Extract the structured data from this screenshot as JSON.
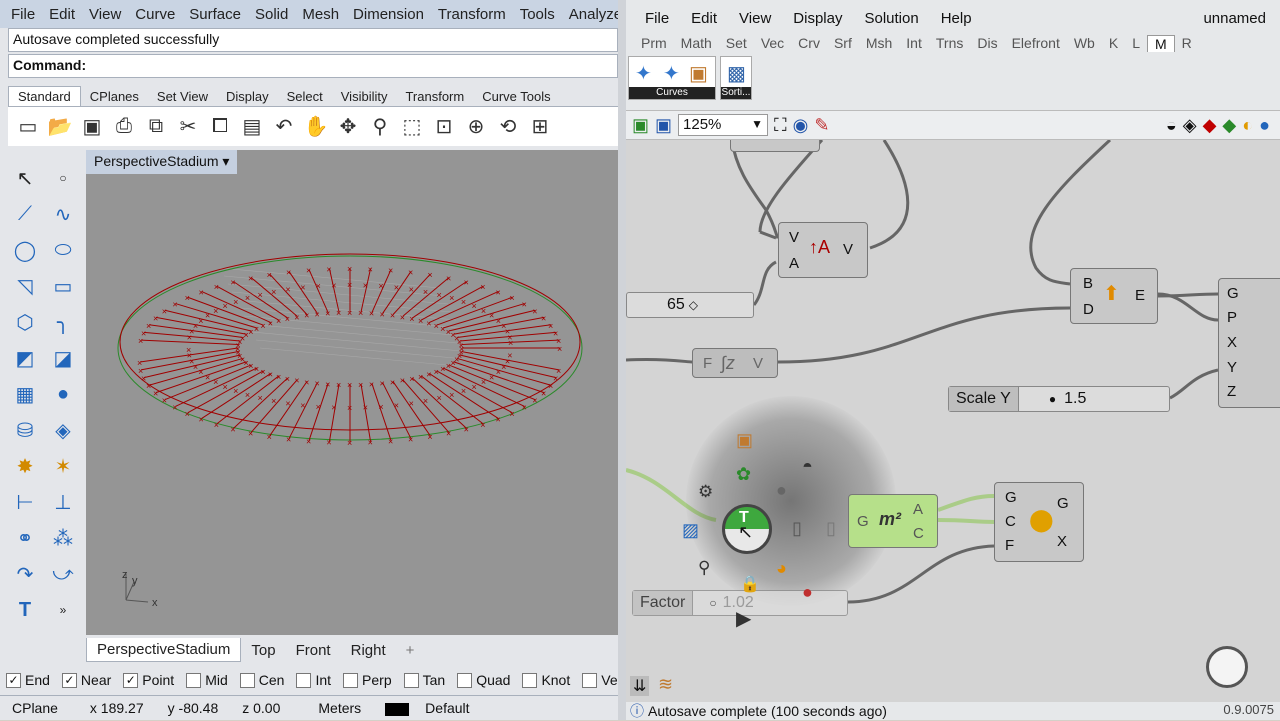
{
  "rhino": {
    "menu": [
      "File",
      "Edit",
      "View",
      "Curve",
      "Surface",
      "Solid",
      "Mesh",
      "Dimension",
      "Transform",
      "Tools",
      "Analyze"
    ],
    "cmd_history": "Autosave completed successfully",
    "command_label": "Command:",
    "tabs": [
      "Standard",
      "CPlanes",
      "Set View",
      "Display",
      "Select",
      "Visibility",
      "Transform",
      "Curve Tools"
    ],
    "viewport_title": "PerspectiveStadium",
    "viewport_tabs": [
      "PerspectiveStadium",
      "Top",
      "Front",
      "Right"
    ],
    "osnaps": [
      {
        "label": "End",
        "checked": true
      },
      {
        "label": "Near",
        "checked": true
      },
      {
        "label": "Point",
        "checked": true
      },
      {
        "label": "Mid",
        "checked": false
      },
      {
        "label": "Cen",
        "checked": false
      },
      {
        "label": "Int",
        "checked": false
      },
      {
        "label": "Perp",
        "checked": false
      },
      {
        "label": "Tan",
        "checked": false
      },
      {
        "label": "Quad",
        "checked": false
      },
      {
        "label": "Knot",
        "checked": false
      },
      {
        "label": "Vertex",
        "checked": false
      }
    ],
    "status": {
      "cplane": "CPlane",
      "x": "x 189.27",
      "y": "y -80.48",
      "z": "z 0.00",
      "units": "Meters",
      "layer": "Default"
    },
    "axis_x": "x",
    "axis_y": "y",
    "axis_z": "z"
  },
  "gh": {
    "menu": [
      "File",
      "Edit",
      "View",
      "Display",
      "Solution",
      "Help"
    ],
    "title": "unnamed",
    "tabs": [
      "Prm",
      "Math",
      "Set",
      "Vec",
      "Crv",
      "Srf",
      "Msh",
      "Int",
      "Trns",
      "Dis",
      "Elefront",
      "Wb",
      "K",
      "L",
      "M",
      "R"
    ],
    "active_tab": "M",
    "ribbon_group1": "Curves",
    "ribbon_group2": "Sorti...",
    "zoom": "125%",
    "components": {
      "cmp1": {
        "in": [
          "V",
          "A"
        ],
        "out": "V"
      },
      "cmp2": {
        "in": [
          "B",
          "D"
        ],
        "out": "E"
      },
      "cmp3": {
        "in": "F",
        "out": "V"
      },
      "cmp4": {
        "in": "G",
        "out": [
          "A",
          "C"
        ]
      },
      "cmp5": {
        "in": [
          "G",
          "C",
          "F"
        ],
        "out": [
          "G",
          "X"
        ]
      },
      "cmp6": {
        "in": [
          "G",
          "P",
          "X",
          "Y",
          "Z"
        ]
      }
    },
    "slider_65": "65",
    "slider_scaley_label": "Scale Y",
    "slider_scaley_value": "1.5",
    "slider_factor_label": "Factor",
    "slider_factor_value": "1.02",
    "status": "Autosave complete (100 seconds ago)",
    "version": "0.9.0075"
  },
  "colors": {
    "accent": "#a00000",
    "curve": "#a00000",
    "green": "#3a9a3a"
  }
}
